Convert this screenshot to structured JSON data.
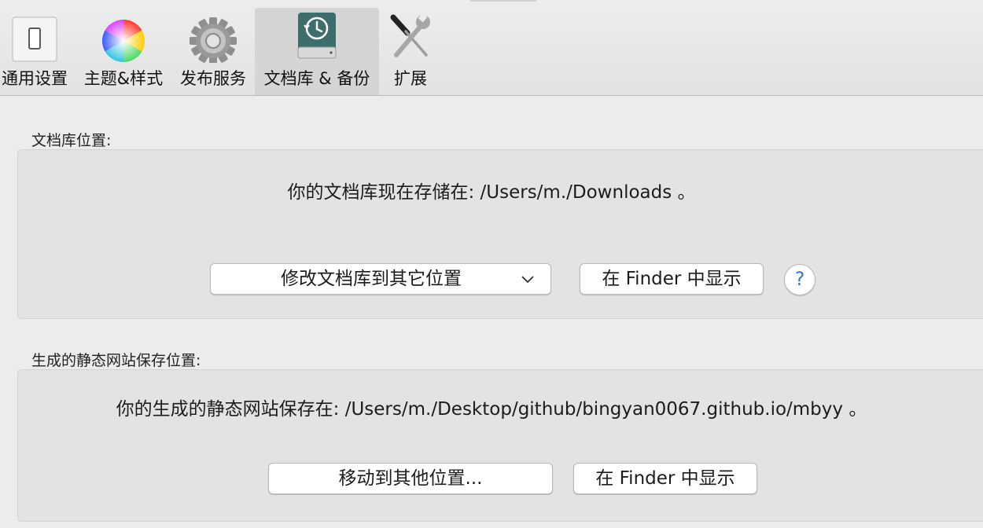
{
  "toolbar": {
    "items": [
      {
        "label": "通用设置",
        "icon": "switch-icon",
        "active": false
      },
      {
        "label": "主题&样式",
        "icon": "color-wheel-icon",
        "active": false
      },
      {
        "label": "发布服务",
        "icon": "gear-icon",
        "active": false
      },
      {
        "label": "文档库 & 备份",
        "icon": "time-machine-drive-icon",
        "active": true
      },
      {
        "label": "扩展",
        "icon": "tools-icon",
        "active": false
      }
    ]
  },
  "library": {
    "section_label": "文档库位置:",
    "info": "你的文档库现在存储在: /Users/m./Downloads 。",
    "change_location_popup": "修改文档库到其它位置",
    "show_in_finder_label": "在 Finder 中显示",
    "help_label": "?"
  },
  "site": {
    "section_label": "生成的静态网站保存位置:",
    "info": "你的生成的静态网站保存在: /Users/m./Desktop/github/bingyan0067.github.io/mbyy 。",
    "move_button_label": "移动到其他位置...",
    "show_in_finder_label": "在 Finder 中显示"
  },
  "colors": {
    "window_bg": "#ececec",
    "panel_bg": "#e3e3e3",
    "active_tab_bg": "#d5d5d5",
    "help_accent": "#2f7ad9"
  }
}
